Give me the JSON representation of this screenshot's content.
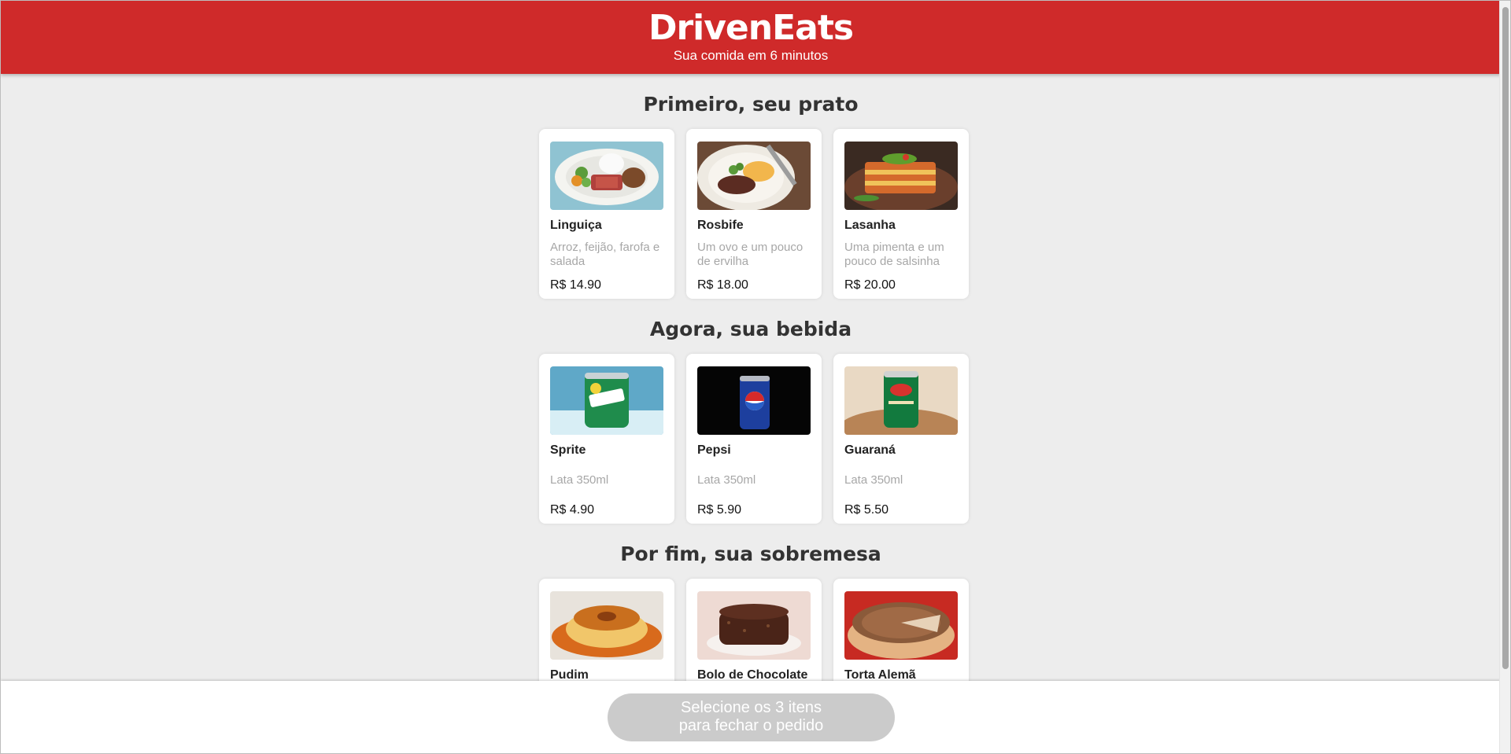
{
  "header": {
    "brand": "DrivenEats",
    "tagline": "Sua comida em 6 minutos"
  },
  "sections": [
    {
      "title": "Primeiro, seu prato",
      "items": [
        {
          "name": "Linguiça",
          "description": "Arroz, feijão, farofa e salada",
          "price": "R$ 14.90",
          "image": "linguica-plate-image"
        },
        {
          "name": "Rosbife",
          "description": "Um ovo e um pouco de ervilha",
          "price": "R$ 18.00",
          "image": "rosbife-plate-image"
        },
        {
          "name": "Lasanha",
          "description": "Uma pimenta e um pouco de salsinha",
          "price": "R$ 20.00",
          "image": "lasanha-plate-image"
        }
      ]
    },
    {
      "title": "Agora, sua bebida",
      "items": [
        {
          "name": "Sprite",
          "description": "Lata 350ml",
          "price": "R$ 4.90",
          "image": "sprite-can-image"
        },
        {
          "name": "Pepsi",
          "description": "Lata 350ml",
          "price": "R$ 5.90",
          "image": "pepsi-can-image"
        },
        {
          "name": "Guaraná",
          "description": "Lata 350ml",
          "price": "R$ 5.50",
          "image": "guarana-can-image"
        }
      ]
    },
    {
      "title": "Por fim, sua sobremesa",
      "items": [
        {
          "name": "Pudim",
          "image": "pudim-dessert-image"
        },
        {
          "name": "Bolo de Chocolate",
          "image": "bolo-chocolate-image"
        },
        {
          "name": "Torta Alemã",
          "image": "torta-alema-image"
        }
      ]
    }
  ],
  "footer": {
    "button_line1": "Selecione os 3 itens",
    "button_line2": "para fechar o pedido"
  },
  "colors": {
    "header_red": "#cf2a2a",
    "page_background": "#ededed",
    "disabled_button": "#cbcbcb"
  }
}
